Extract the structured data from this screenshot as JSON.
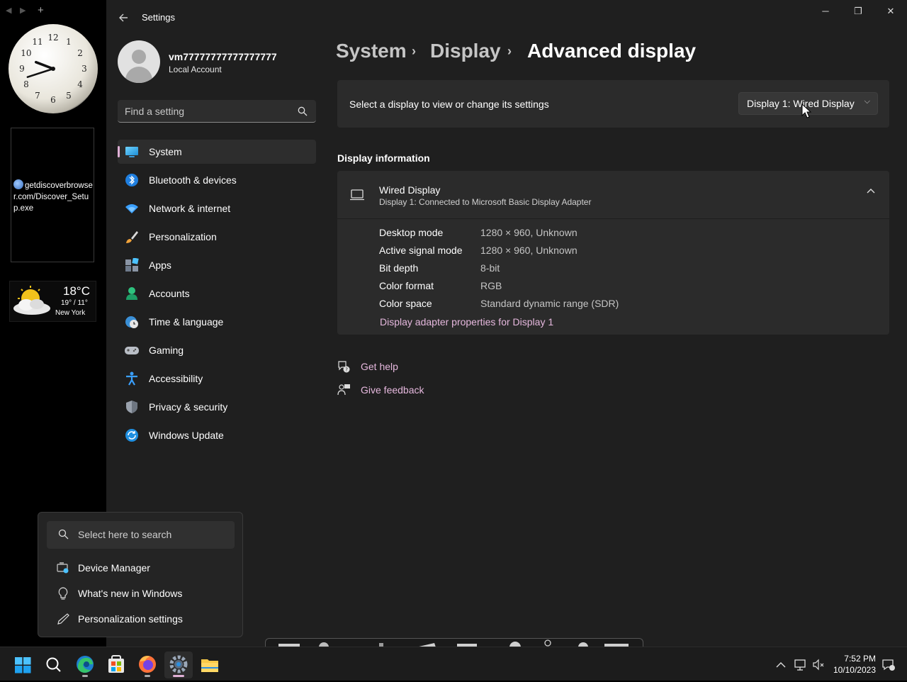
{
  "widgets": {
    "clock": {
      "numbers": [
        "12",
        "1",
        "2",
        "3",
        "4",
        "5",
        "6",
        "7",
        "8",
        "9",
        "10",
        "11"
      ],
      "hour": 9,
      "minute": 42
    },
    "download_text": "getdiscoverbrowser.com/Discover_Setup.exe",
    "weather": {
      "temp": "18°C",
      "range": "19° / 11°",
      "city": "New York"
    }
  },
  "window": {
    "title": "Settings",
    "back_icon": "back-arrow-icon",
    "controls": {
      "minimize": "─",
      "restore": "❐",
      "close": "✕"
    }
  },
  "user": {
    "name": "vm77777777777777777",
    "account_type": "Local Account"
  },
  "search": {
    "placeholder": "Find a setting"
  },
  "nav": {
    "items": [
      {
        "label": "System",
        "icon": "system-icon",
        "active": true
      },
      {
        "label": "Bluetooth & devices",
        "icon": "bluetooth-icon"
      },
      {
        "label": "Network & internet",
        "icon": "wifi-icon"
      },
      {
        "label": "Personalization",
        "icon": "brush-icon"
      },
      {
        "label": "Apps",
        "icon": "apps-icon"
      },
      {
        "label": "Accounts",
        "icon": "person-icon"
      },
      {
        "label": "Time & language",
        "icon": "globe-clock-icon"
      },
      {
        "label": "Gaming",
        "icon": "controller-icon"
      },
      {
        "label": "Accessibility",
        "icon": "accessibility-icon"
      },
      {
        "label": "Privacy & security",
        "icon": "shield-icon"
      },
      {
        "label": "Windows Update",
        "icon": "update-icon"
      }
    ]
  },
  "breadcrumb": {
    "level1": "System",
    "level2": "Display",
    "current": "Advanced display",
    "separator": "›"
  },
  "display_select": {
    "label": "Select a display to view or change its settings",
    "selected": "Display 1: Wired Display",
    "chevron": "⌵"
  },
  "display_info": {
    "section_title": "Display information",
    "name": "Wired Display",
    "subtitle": "Display 1: Connected to Microsoft Basic Display Adapter",
    "collapse_icon": "^",
    "properties": [
      {
        "label": "Desktop mode",
        "value": "1280 × 960, Unknown"
      },
      {
        "label": "Active signal mode",
        "value": "1280 × 960, Unknown"
      },
      {
        "label": "Bit depth",
        "value": "8-bit"
      },
      {
        "label": "Color format",
        "value": "RGB"
      },
      {
        "label": "Color space",
        "value": "Standard dynamic range (SDR)"
      }
    ],
    "adapter_link": "Display adapter properties for Display 1"
  },
  "help": {
    "get_help": "Get help",
    "give_feedback": "Give feedback"
  },
  "flyout": {
    "placeholder": "Select here to search",
    "items": [
      {
        "label": "Device Manager",
        "icon": "device-manager-icon"
      },
      {
        "label": "What's new in Windows",
        "icon": "lightbulb-icon"
      },
      {
        "label": "Personalization settings",
        "icon": "pen-icon"
      }
    ]
  },
  "taskbar": {
    "apps": [
      {
        "name": "start-button",
        "icon": "windows-logo-icon"
      },
      {
        "name": "search-button",
        "icon": "search-icon"
      },
      {
        "name": "edge-app",
        "icon": "edge-icon"
      },
      {
        "name": "store-app",
        "icon": "store-icon"
      },
      {
        "name": "firefox-app",
        "icon": "firefox-icon"
      },
      {
        "name": "settings-app",
        "icon": "gear-icon"
      },
      {
        "name": "explorer-app",
        "icon": "folder-icon"
      }
    ],
    "time": "7:52 PM",
    "date": "10/10/2023"
  },
  "colors": {
    "accent": "#e0b0d6",
    "link": "#e6b8de",
    "card": "#2b2b2b",
    "background": "#1f1f1f"
  }
}
